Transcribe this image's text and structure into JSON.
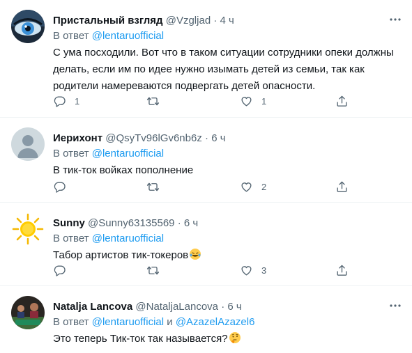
{
  "colors": {
    "accent": "#1d9bf0",
    "secondary_text": "#536471",
    "divider": "#eff3f4"
  },
  "tweets": [
    {
      "name": "Пристальный взгляд",
      "handle": "@Vzgljad",
      "dot": "·",
      "time": "4 ч",
      "reply_prefix": "В ответ",
      "reply_to": "@lentaruofficial",
      "text": "С ума посходили. Вот что в таком ситуации сотрудники опеки должны делать, если им по идее нужно изымать детей из семьи, так как родители намереваются подвергать детей опасности.",
      "replies": "1",
      "retweets": "",
      "likes": "1"
    },
    {
      "name": "Иерихонт",
      "handle": "@QsyTv96lGv6nb6z",
      "dot": "·",
      "time": "6 ч",
      "reply_prefix": "В ответ",
      "reply_to": "@lentaruofficial",
      "text": "В тик-ток войках пополнение",
      "replies": "",
      "retweets": "",
      "likes": "2"
    },
    {
      "name": "Sunny",
      "handle": "@Sunny63135569",
      "dot": "·",
      "time": "6 ч",
      "reply_prefix": "В ответ",
      "reply_to": "@lentaruofficial",
      "text": "Табор артистов тик-токеров",
      "emoji": "laughing-tears-emoji",
      "replies": "",
      "retweets": "",
      "likes": "3"
    },
    {
      "name": "Natalja Lancova",
      "handle": "@NataljaLancova",
      "dot": "·",
      "time": "6 ч",
      "reply_prefix": "В ответ",
      "reply_to": "@lentaruofficial",
      "reply_and": "и",
      "reply_to_2": "@AzazelAzazel6",
      "text": "Это теперь Тик-ток так называется?",
      "emoji": "thinking-face-emoji"
    }
  ]
}
